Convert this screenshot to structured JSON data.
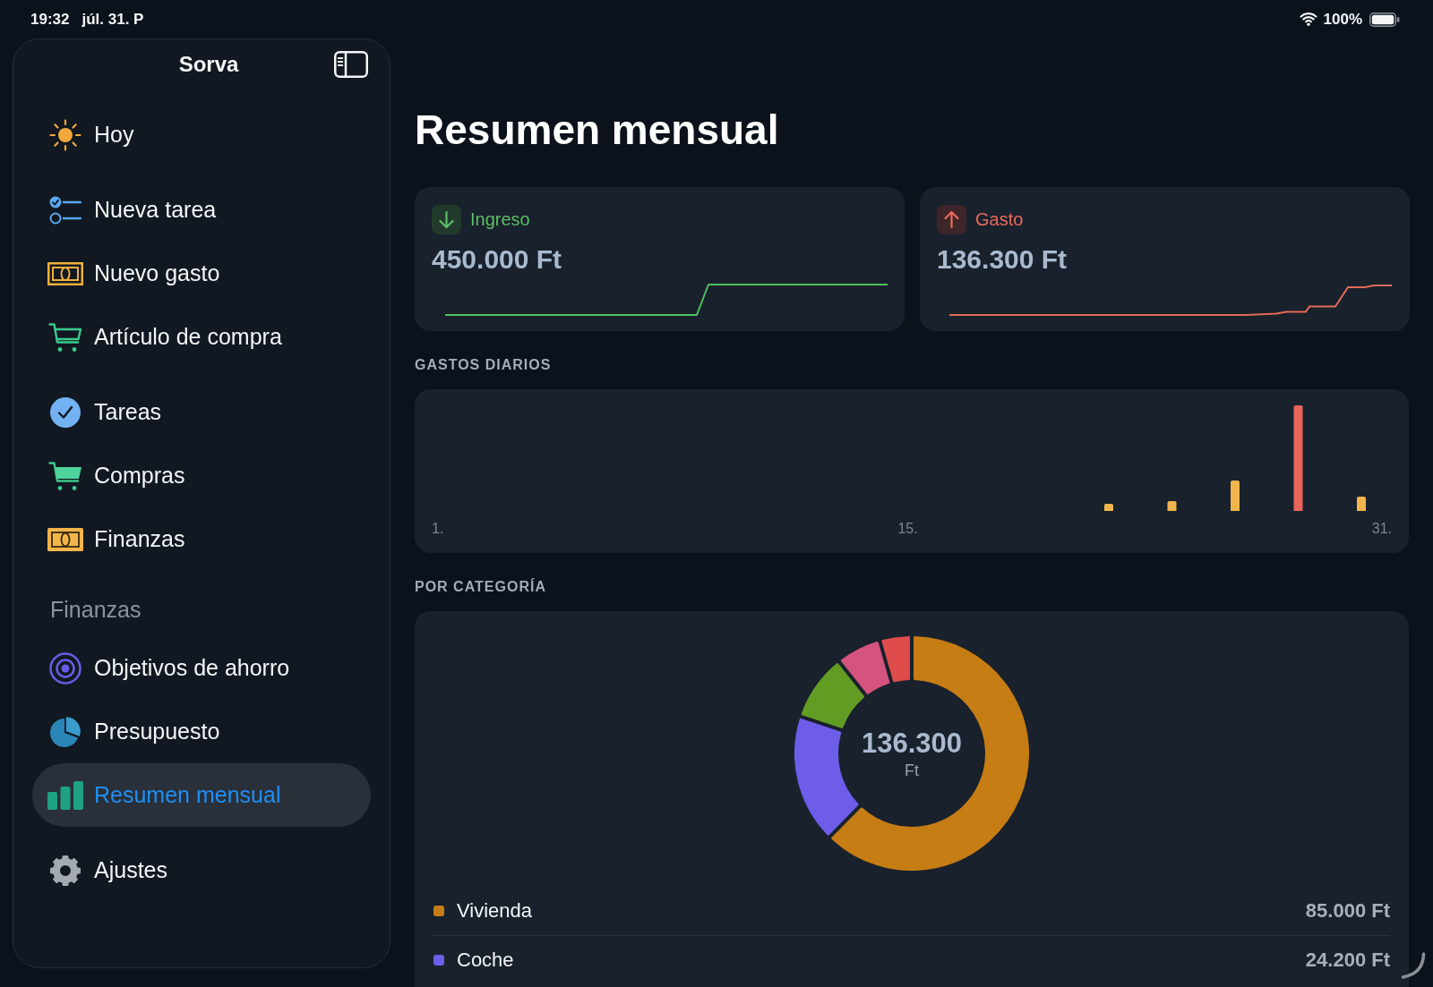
{
  "status_bar": {
    "time": "19:32",
    "date": "júl. 31. P",
    "battery": "100%"
  },
  "sidebar": {
    "title": "Sorva",
    "groups": [
      {
        "items": [
          {
            "label": "Hoy",
            "selected": false
          }
        ]
      },
      {
        "items": [
          {
            "label": "Nueva tarea",
            "selected": false
          },
          {
            "label": "Nuevo gasto",
            "selected": false
          },
          {
            "label": "Artículo de compra",
            "selected": false
          }
        ]
      },
      {
        "items": [
          {
            "label": "Tareas",
            "selected": false
          },
          {
            "label": "Compras",
            "selected": false
          },
          {
            "label": "Finanzas",
            "selected": false
          }
        ]
      },
      {
        "header": "Finanzas",
        "items": [
          {
            "label": "Objetivos de ahorro",
            "selected": false
          },
          {
            "label": "Presupuesto",
            "selected": false
          },
          {
            "label": "Resumen mensual",
            "selected": true
          }
        ]
      },
      {
        "items": [
          {
            "label": "Ajustes",
            "selected": false
          }
        ]
      }
    ]
  },
  "page": {
    "title": "Resumen mensual",
    "summary_cards": [
      {
        "kind": "income",
        "label": "Ingreso",
        "amount": "450.000 Ft"
      },
      {
        "kind": "expense",
        "label": "Gasto",
        "amount": "136.300 Ft"
      }
    ],
    "daily_expenses": {
      "heading": "GASTOS DIARIOS",
      "axis_labels": [
        "1.",
        "15.",
        "31."
      ]
    },
    "by_category": {
      "heading": "POR CATEGORÍA",
      "total": "136.300",
      "unit": "Ft",
      "chart_data": {
        "type": "donut",
        "values": [
          62.36,
          17.76,
          9.24,
          6.24,
          4.4
        ],
        "colors": [
          "#c67d14",
          "#6d5de9",
          "#639c23",
          "#d5547f",
          "#e04b4b"
        ]
      },
      "legend": [
        {
          "label": "Vivienda",
          "value": "85.000 Ft",
          "color": "#c67d14"
        },
        {
          "label": "Coche",
          "value": "24.200 Ft",
          "color": "#6d5de9"
        }
      ]
    }
  }
}
